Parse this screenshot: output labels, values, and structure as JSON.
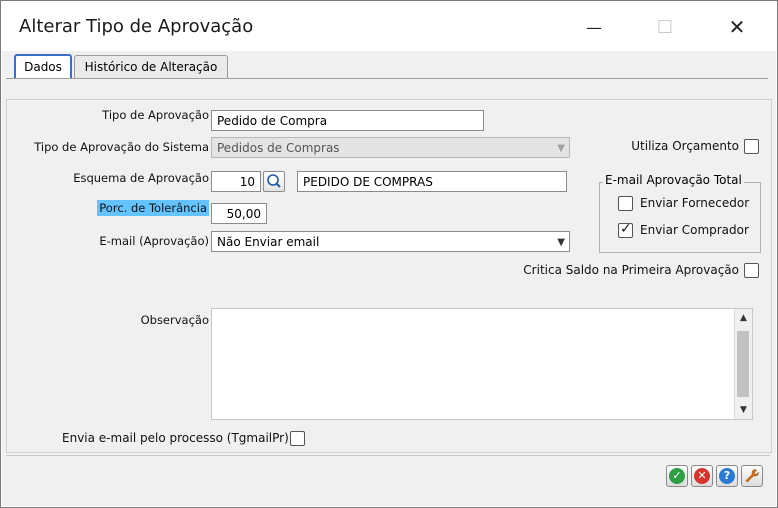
{
  "window": {
    "title": "Alterar Tipo de Aprovação",
    "minimize_glyph": "—",
    "maximize_glyph": "☐",
    "close_glyph": "✕"
  },
  "tabs": [
    {
      "label": "Dados",
      "active": true
    },
    {
      "label": "Histórico de Alteração",
      "active": false
    }
  ],
  "form": {
    "tipo_aprovacao": {
      "label": "Tipo de Aprovação",
      "value": "Pedido de Compra"
    },
    "tipo_aprovacao_sistema": {
      "label": "Tipo de Aprovação do Sistema",
      "value": "Pedidos de Compras",
      "disabled": true
    },
    "esquema_aprovacao": {
      "label": "Esquema de Aprovação",
      "code": "10",
      "description": "PEDIDO DE COMPRAS"
    },
    "porc_tolerancia": {
      "label": "Porc. de Tolerância",
      "value": "50,00"
    },
    "email_aprovacao": {
      "label": "E-mail (Aprovação)",
      "value": "Não Enviar email"
    },
    "observacao": {
      "label": "Observação",
      "value": ""
    },
    "envia_email": {
      "label": "Envia e-mail pelo processo (TgmailPr)",
      "checked": false
    }
  },
  "right_panel": {
    "utiliza_orcamento": {
      "label": "Utiliza Orçamento",
      "checked": false
    },
    "email_aprovacao_total": {
      "title": "E-mail Aprovação Total",
      "enviar_fornecedor": {
        "label": "Enviar Fornecedor",
        "checked": false
      },
      "enviar_comprador": {
        "label": "Enviar Comprador",
        "checked": true
      }
    },
    "critica_saldo": {
      "label": "Critica Saldo na Primeira Aprovação",
      "checked": false
    }
  },
  "icons": {
    "check_mark": "✓",
    "dropdown_arrow": "▼",
    "scroll_up": "▲",
    "scroll_down": "▼",
    "ok_glyph": "✓",
    "cancel_glyph": "✕",
    "help_glyph": "?",
    "tool_glyph": "🔧"
  },
  "colors": {
    "highlight": "#63c3ff",
    "ok": "#2ea043",
    "cancel": "#d9342b",
    "help": "#2a7bd6",
    "tool": "#e07b1a"
  }
}
